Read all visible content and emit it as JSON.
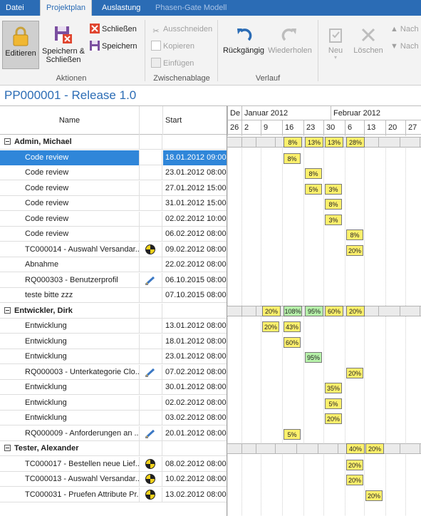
{
  "menu": {
    "tabs": [
      {
        "label": "Datei"
      },
      {
        "label": "Projektplan"
      },
      {
        "label": "Auslastung"
      },
      {
        "label": "Phasen-Gate Modell"
      }
    ]
  },
  "ribbon": {
    "edit_label": "Editieren",
    "save_close_label": "Speichern & Schließen",
    "close_label": "Schließen",
    "save_label": "Speichern",
    "cut_label": "Ausschneiden",
    "copy_label": "Kopieren",
    "paste_label": "Einfügen",
    "undo_label": "Rückgängig",
    "redo_label": "Wiederholen",
    "new_label": "Neu",
    "delete_label": "Löschen",
    "next_up_label": "Nach",
    "next_down_label": "Nach",
    "groups": {
      "actions": "Aktionen",
      "clipboard": "Zwischenablage",
      "history": "Verlauf"
    }
  },
  "page_title": "PP000001 - Release 1.0",
  "grid": {
    "col_name": "Name",
    "col_start": "Start",
    "rows": [
      {
        "name": "Admin, Michael",
        "start": "",
        "group": true
      },
      {
        "name": "Code review",
        "start": "18.01.2012 09:00",
        "selected": true
      },
      {
        "name": "Code review",
        "start": "23.01.2012 08:00"
      },
      {
        "name": "Code review",
        "start": "27.01.2012 15:00"
      },
      {
        "name": "Code review",
        "start": "31.01.2012 15:00"
      },
      {
        "name": "Code review",
        "start": "02.02.2012 10:00"
      },
      {
        "name": "Code review",
        "start": "06.02.2012 08:00"
      },
      {
        "name": "TC000014 - Auswahl Versandar...",
        "start": "09.02.2012 08:00",
        "icon": "testcase"
      },
      {
        "name": "Abnahme",
        "start": "22.02.2012 08:00"
      },
      {
        "name": "RQ000303 - Benutzerprofil",
        "start": "06.10.2015 08:00",
        "icon": "requirement"
      },
      {
        "name": "teste bitte zzz",
        "start": "07.10.2015 08:00"
      },
      {
        "name": "Entwickler, Dirk",
        "start": "",
        "group": true
      },
      {
        "name": "Entwicklung",
        "start": "13.01.2012 08:00"
      },
      {
        "name": "Entwicklung",
        "start": "18.01.2012 08:00"
      },
      {
        "name": "Entwicklung",
        "start": "23.01.2012 08:00"
      },
      {
        "name": "RQ000003 - Unterkategorie Clo...",
        "start": "07.02.2012 08:00",
        "icon": "requirement"
      },
      {
        "name": "Entwicklung",
        "start": "30.01.2012 08:00"
      },
      {
        "name": "Entwicklung",
        "start": "02.02.2012 08:00"
      },
      {
        "name": "Entwicklung",
        "start": "03.02.2012 08:00"
      },
      {
        "name": "RQ000009 - Anforderungen an ...",
        "start": "20.01.2012 08:00",
        "icon": "requirement"
      },
      {
        "name": "Tester, Alexander",
        "start": "",
        "group": true
      },
      {
        "name": "TC000017 - Bestellen neue Lief...",
        "start": "08.02.2012 08:00",
        "icon": "testcase"
      },
      {
        "name": "TC000013 - Auswahl Versandar...",
        "start": "10.02.2012 08:00",
        "icon": "testcase"
      },
      {
        "name": "TC000031 - Pruefen Attribute Pr...",
        "start": "13.02.2012 08:00",
        "icon": "testcase"
      }
    ]
  },
  "gantt": {
    "months": [
      "De",
      "Januar 2012",
      "Februar 2012"
    ],
    "weeks": [
      "26",
      "2",
      "9",
      "16",
      "23",
      "30",
      "6",
      "13",
      "20",
      "27"
    ],
    "summary_rows": [
      {
        "row": 0,
        "cells": [
          {
            "week": 3,
            "label": "8%"
          },
          {
            "week": 4,
            "label": "13%"
          },
          {
            "week": 5,
            "label": "13%"
          },
          {
            "week": 6,
            "label": "28%"
          }
        ]
      },
      {
        "row": 11,
        "cells": [
          {
            "week": 2,
            "label": "20%"
          },
          {
            "week": 3,
            "label": "108%",
            "color": "green"
          },
          {
            "week": 4,
            "label": "95%",
            "color": "green"
          },
          {
            "week": 5,
            "label": "60%"
          },
          {
            "week": 6,
            "label": "20%"
          }
        ]
      },
      {
        "row": 20,
        "cells": [
          {
            "week": 6,
            "label": "40%"
          },
          {
            "week": 7,
            "label": "20%"
          }
        ]
      }
    ],
    "bars": [
      {
        "row": 1,
        "week": 3,
        "span": 1,
        "label": "8%"
      },
      {
        "row": 2,
        "week": 4,
        "span": 1,
        "label": "8%"
      },
      {
        "row": 3,
        "week": 4,
        "span": 1,
        "label": "5%"
      },
      {
        "row": 3,
        "week": 5,
        "span": 1,
        "label": "3%"
      },
      {
        "row": 4,
        "week": 5,
        "span": 1,
        "label": "8%"
      },
      {
        "row": 5,
        "week": 5,
        "span": 1,
        "label": "3%"
      },
      {
        "row": 6,
        "week": 6,
        "span": 1,
        "label": "8%"
      },
      {
        "row": 7,
        "week": 6,
        "span": 1,
        "label": "20%"
      },
      {
        "row": 12,
        "week": 2,
        "span": 1,
        "label": "20%"
      },
      {
        "row": 12,
        "week": 3,
        "span": 1,
        "label": "43%"
      },
      {
        "row": 13,
        "week": 3,
        "span": 1,
        "label": "60%"
      },
      {
        "row": 14,
        "week": 4,
        "span": 1,
        "label": "95%",
        "color": "green"
      },
      {
        "row": 15,
        "week": 6,
        "span": 1,
        "label": "20%"
      },
      {
        "row": 16,
        "week": 5,
        "span": 1,
        "label": "35%"
      },
      {
        "row": 17,
        "week": 5,
        "span": 1,
        "label": "5%"
      },
      {
        "row": 18,
        "week": 5,
        "span": 1,
        "label": "20%"
      },
      {
        "row": 19,
        "week": 3,
        "span": 1,
        "label": "5%"
      },
      {
        "row": 21,
        "week": 6,
        "span": 1,
        "label": "20%"
      },
      {
        "row": 22,
        "week": 6,
        "span": 1,
        "label": "20%"
      },
      {
        "row": 23,
        "week": 7,
        "span": 1,
        "label": "20%"
      }
    ]
  },
  "colors": {
    "accent": "#2b6cb5",
    "selection": "#2f86d9",
    "bar_yellow": "#fdf06c",
    "bar_green": "#b6f1a9"
  }
}
